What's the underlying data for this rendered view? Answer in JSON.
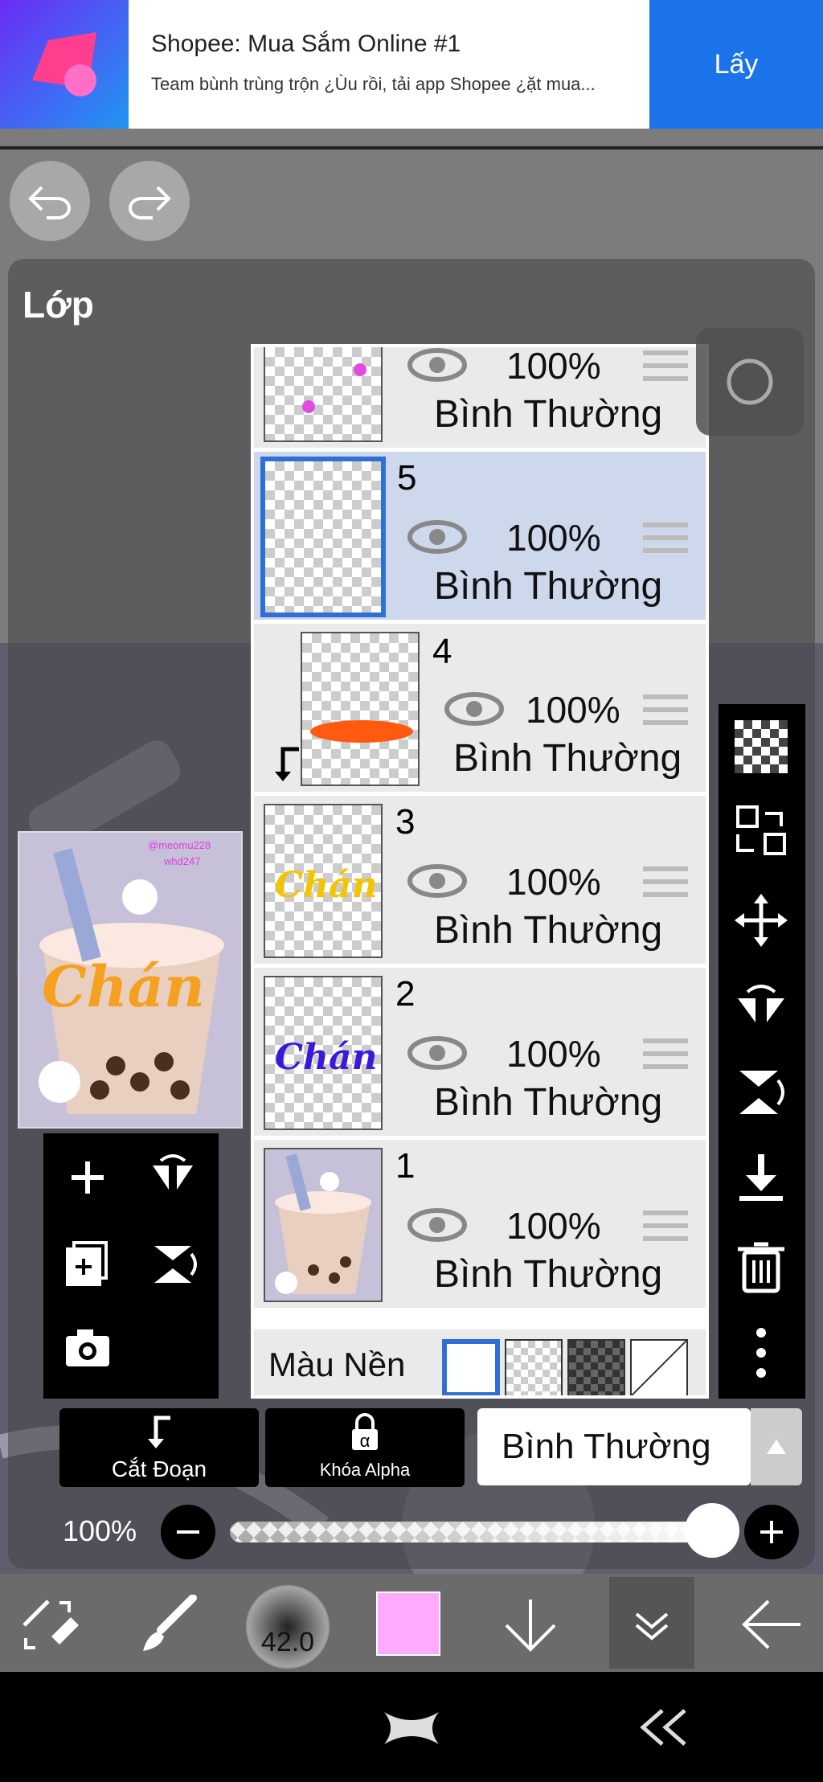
{
  "ad": {
    "title": "Shopee: Mua Sắm Online #1",
    "description": "Team bùnh trùng trộn ¿Ùu rồi, tải app Shopee ¿ặt mua...",
    "button": "Lấy"
  },
  "panel": {
    "title": "Lớp"
  },
  "layers": [
    {
      "number": "",
      "opacity": "100%",
      "mode": "Bình Thường"
    },
    {
      "number": "5",
      "opacity": "100%",
      "mode": "Bình Thường",
      "selected": true
    },
    {
      "number": "4",
      "opacity": "100%",
      "mode": "Bình Thường",
      "clipped": true
    },
    {
      "number": "3",
      "opacity": "100%",
      "mode": "Bình Thường",
      "thumb_text": "Chán"
    },
    {
      "number": "2",
      "opacity": "100%",
      "mode": "Bình Thường",
      "thumb_text": "Chán"
    },
    {
      "number": "1",
      "opacity": "100%",
      "mode": "Bình Thường"
    }
  ],
  "background_row": {
    "label": "Màu Nền"
  },
  "preview": {
    "credit1": "@meomu228",
    "credit2": "whd247",
    "text": "Chán"
  },
  "buttons": {
    "clip": "Cắt Đoạn",
    "alpha_lock": "Khóa Alpha",
    "blend_mode": "Bình Thường"
  },
  "opacity": {
    "label": "100%",
    "value": 1.0
  },
  "toolbar": {
    "brush_size": "42.0",
    "color": "#ffaaff"
  },
  "colors": {
    "accent": "#1a73e8",
    "selected_layer": "#cdd8ec"
  }
}
